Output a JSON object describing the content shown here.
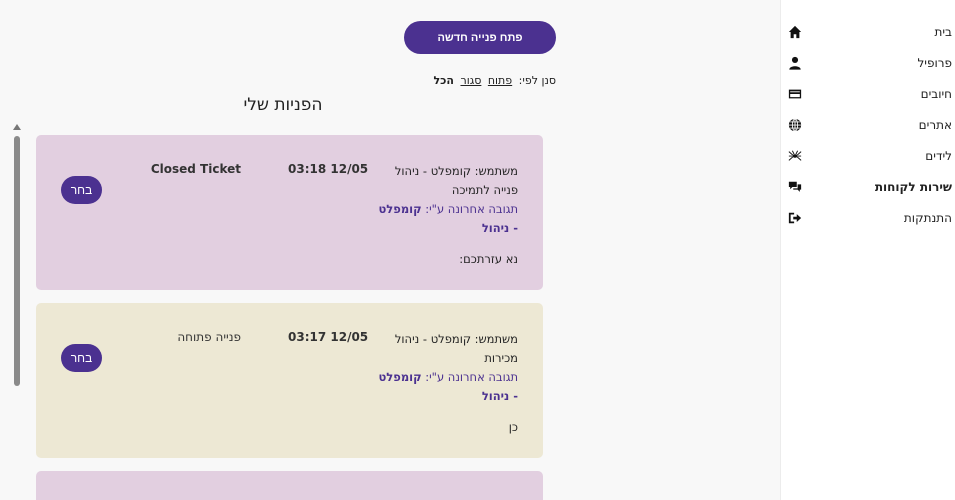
{
  "sidebar": {
    "items": [
      {
        "label": "בית",
        "icon": "home-icon",
        "active": false
      },
      {
        "label": "פרופיל",
        "icon": "user-icon",
        "active": false
      },
      {
        "label": "חיובים",
        "icon": "credit-card-icon",
        "active": false
      },
      {
        "label": "אתרים",
        "icon": "globe-icon",
        "active": false
      },
      {
        "label": "לידים",
        "icon": "spider-icon",
        "active": false
      },
      {
        "label": "שירות לקוחות",
        "icon": "chat-bubbles-icon",
        "active": true
      },
      {
        "label": "התנתקות",
        "icon": "logout-icon",
        "active": false
      }
    ]
  },
  "main": {
    "new_ticket_label": "פתח פנייה חדשה",
    "filter": {
      "prefix": "סנן לפי:",
      "open": "פתוח",
      "closed": "סגור",
      "all": "הכל",
      "selected": "all"
    },
    "title": "הפניות שלי",
    "tickets": [
      {
        "user": "משתמש: קומפלט - ניהול",
        "subject": "פנייה לתמיכה",
        "last_reply_prefix": "תגובה אחרונה ע\"י:",
        "last_reply_by": "קומפלט - ניהול",
        "body": "נא עזרתכם:",
        "date": "03:18 12/05",
        "status": "Closed Ticket",
        "select_label": "בחר",
        "bg_color": "#e2cfe0"
      },
      {
        "user": "משתמש: קומפלט - ניהול",
        "subject": "מכירות",
        "last_reply_prefix": "תגובה אחרונה ע\"י:",
        "last_reply_by": "קומפלט - ניהול",
        "body": "כן",
        "date": "03:17 12/05",
        "status": "פנייה פתוחה",
        "select_label": "בחר",
        "bg_color": "#ede8d4"
      }
    ],
    "partial_card_color": "#e2cfe0"
  },
  "colors": {
    "accent": "#4b3190"
  }
}
